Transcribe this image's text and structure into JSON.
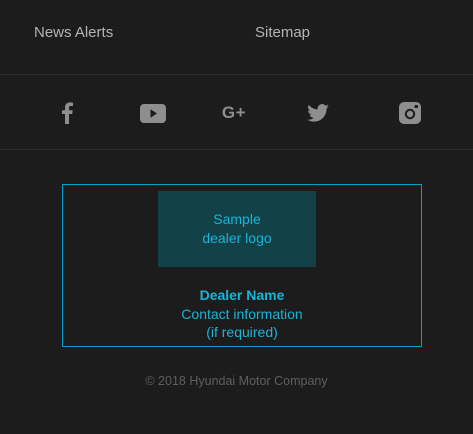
{
  "footer_links": {
    "news_alerts": "News Alerts",
    "sitemap": "Sitemap"
  },
  "social": {
    "icons": [
      "facebook-icon",
      "youtube-icon",
      "google-plus-icon",
      "twitter-icon",
      "instagram-icon"
    ],
    "google_plus_text": "G+"
  },
  "dealer": {
    "logo_line1": "Sample",
    "logo_line2": "dealer logo",
    "name": "Dealer Name",
    "contact_line1": "Contact information",
    "contact_line2": "(if required)"
  },
  "copyright": "© 2018 Hyundai Motor Company",
  "colors": {
    "background": "#1c1c1c",
    "accent": "#19b4d8",
    "logo_bg": "#124247",
    "link_text": "#b4b4b4",
    "icon": "#8e8e8e"
  }
}
